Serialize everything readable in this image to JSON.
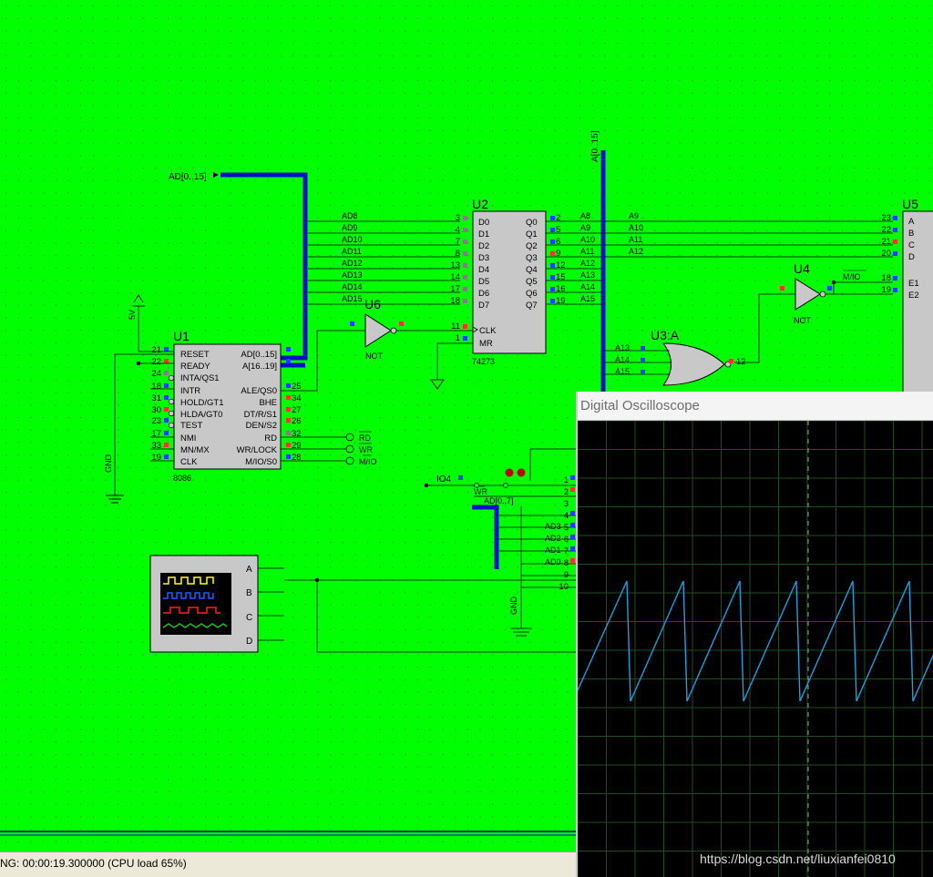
{
  "schematic": {
    "background_color": "#00ff00",
    "bus_color": "#0010c8",
    "u1": {
      "ref": "U1",
      "part": "8086",
      "left_pins": [
        {
          "num": "21",
          "name": "RESET"
        },
        {
          "num": "22",
          "name": "READY"
        },
        {
          "num": "24",
          "name": "INTA/QS1"
        },
        {
          "num": "18",
          "name": "INTR"
        },
        {
          "num": "31",
          "name": "HOLD/GT1"
        },
        {
          "num": "30",
          "name": "HLDA/GT0"
        },
        {
          "num": "23",
          "name": "TEST"
        },
        {
          "num": "17",
          "name": "NMI"
        },
        {
          "num": "33",
          "name": "MN/MX"
        },
        {
          "num": "19",
          "name": "CLK"
        }
      ],
      "right_pins": [
        {
          "num": "",
          "name": "AD[0..15]"
        },
        {
          "num": "",
          "name": "A[16..19]"
        },
        {
          "num": "25",
          "name": "ALE/QS0"
        },
        {
          "num": "34",
          "name": "BHE"
        },
        {
          "num": "27",
          "name": "DT/R/S1"
        },
        {
          "num": "26",
          "name": "DEN/S2"
        },
        {
          "num": "32",
          "name": "RD"
        },
        {
          "num": "29",
          "name": "WR/LOCK"
        },
        {
          "num": "28",
          "name": "M/IO/S0"
        }
      ]
    },
    "u2": {
      "ref": "U2",
      "part": "74273",
      "d_pins": [
        {
          "num": "3",
          "name": "D0",
          "net": "AD8"
        },
        {
          "num": "4",
          "name": "D1",
          "net": "AD9"
        },
        {
          "num": "7",
          "name": "D2",
          "net": "AD10"
        },
        {
          "num": "8",
          "name": "D3",
          "net": "AD11"
        },
        {
          "num": "13",
          "name": "D4",
          "net": "AD12"
        },
        {
          "num": "14",
          "name": "D5",
          "net": "AD13"
        },
        {
          "num": "17",
          "name": "D6",
          "net": "AD14"
        },
        {
          "num": "18",
          "name": "D7",
          "net": "AD15"
        }
      ],
      "q_pins": [
        {
          "num": "2",
          "name": "Q0",
          "net": "A8"
        },
        {
          "num": "5",
          "name": "Q1",
          "net": "A9"
        },
        {
          "num": "6",
          "name": "Q2",
          "net": "A10"
        },
        {
          "num": "9",
          "name": "Q3",
          "net": "A11"
        },
        {
          "num": "12",
          "name": "Q4",
          "net": "A12"
        },
        {
          "num": "15",
          "name": "Q5",
          "net": "A13"
        },
        {
          "num": "16",
          "name": "Q6",
          "net": "A14"
        },
        {
          "num": "19",
          "name": "Q7",
          "net": "A15"
        }
      ],
      "clk": {
        "num": "11",
        "name": "CLK"
      },
      "mr": {
        "num": "1",
        "name": "MR"
      }
    },
    "u5": {
      "ref": "U5",
      "pins": [
        {
          "num": "23",
          "name": "A",
          "net": "A9"
        },
        {
          "num": "22",
          "name": "B",
          "net": "A10"
        },
        {
          "num": "21",
          "name": "C",
          "net": "A11"
        },
        {
          "num": "20",
          "name": "D",
          "net": "A12"
        },
        {
          "num": "18",
          "name": "E1",
          "net": "M/IO"
        },
        {
          "num": "19",
          "name": "E2",
          "net": ""
        }
      ]
    },
    "u6": {
      "ref": "U6",
      "part": "NOT"
    },
    "u4": {
      "ref": "U4",
      "part": "NOT"
    },
    "u3": {
      "ref": "U3:A",
      "inputs": [
        "A13",
        "A14",
        "A15"
      ],
      "output_pin": "12"
    },
    "labels": {
      "ad_bus": "AD[0..15]",
      "a_bus": "A[0..15]",
      "ad_low_bus": "AD[0..7]",
      "supply": "5V",
      "gnd": "GND",
      "io4": "IO4",
      "wr_net": "WR",
      "rd_term": "RD",
      "wr_term": "WR",
      "mio_term": "M/IO",
      "mio_net": "M/IO"
    },
    "lower_connector": {
      "pins": [
        {
          "num": "1",
          "net": ""
        },
        {
          "num": "2",
          "net": ""
        },
        {
          "num": "3",
          "net": ""
        },
        {
          "num": "4",
          "net": "AD3"
        },
        {
          "num": "5",
          "net": "AD2"
        },
        {
          "num": "6",
          "net": "AD1"
        },
        {
          "num": "7",
          "net": "AD0"
        },
        {
          "num": "8",
          "net": ""
        },
        {
          "num": "9",
          "net": ""
        },
        {
          "num": "10",
          "net": ""
        }
      ]
    },
    "scope_instrument": {
      "channels": [
        "A",
        "B",
        "C",
        "D"
      ]
    }
  },
  "status_bar": {
    "text": "NG: 00:00:19.300000 (CPU load 65%)"
  },
  "oscilloscope": {
    "title": "Digital Oscilloscope",
    "trace_color": "#1ea0dc",
    "grid_color": "#1f4d1f",
    "waveform": "sawtooth"
  },
  "watermark": "https://blog.csdn.net/liuxianfei0810"
}
